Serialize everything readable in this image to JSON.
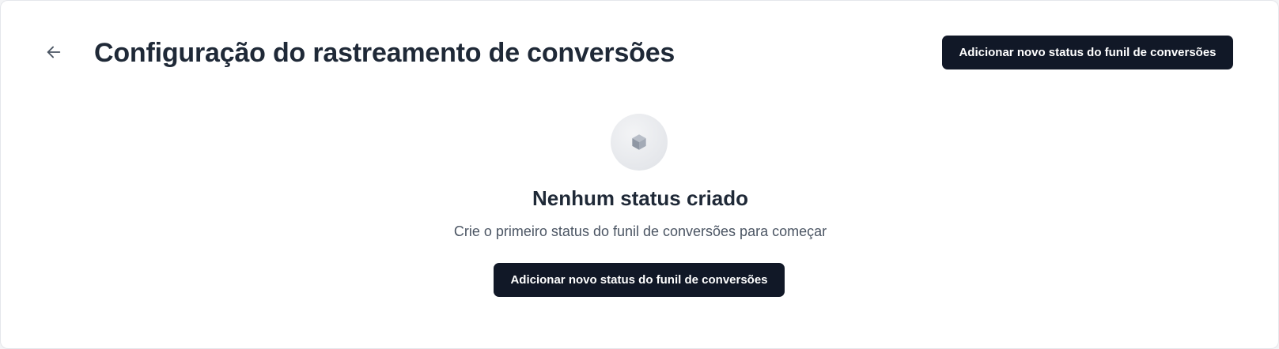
{
  "header": {
    "back_icon": "arrow-left-icon",
    "title": "Configuração do rastreamento de conversões",
    "add_button_label": "Adicionar novo status do funil de conversões"
  },
  "empty_state": {
    "icon": "cube-icon",
    "title": "Nenhum status criado",
    "subtitle": "Crie o primeiro status do funil de conversões para começar",
    "add_button_label": "Adicionar novo status do funil de conversões"
  },
  "colors": {
    "page_background": "#f3f4f6",
    "panel_background": "#ffffff",
    "primary_button": "#111827",
    "title_text": "#1f2937",
    "muted_text": "#4b5563",
    "icon_gray": "#9ca3af"
  }
}
